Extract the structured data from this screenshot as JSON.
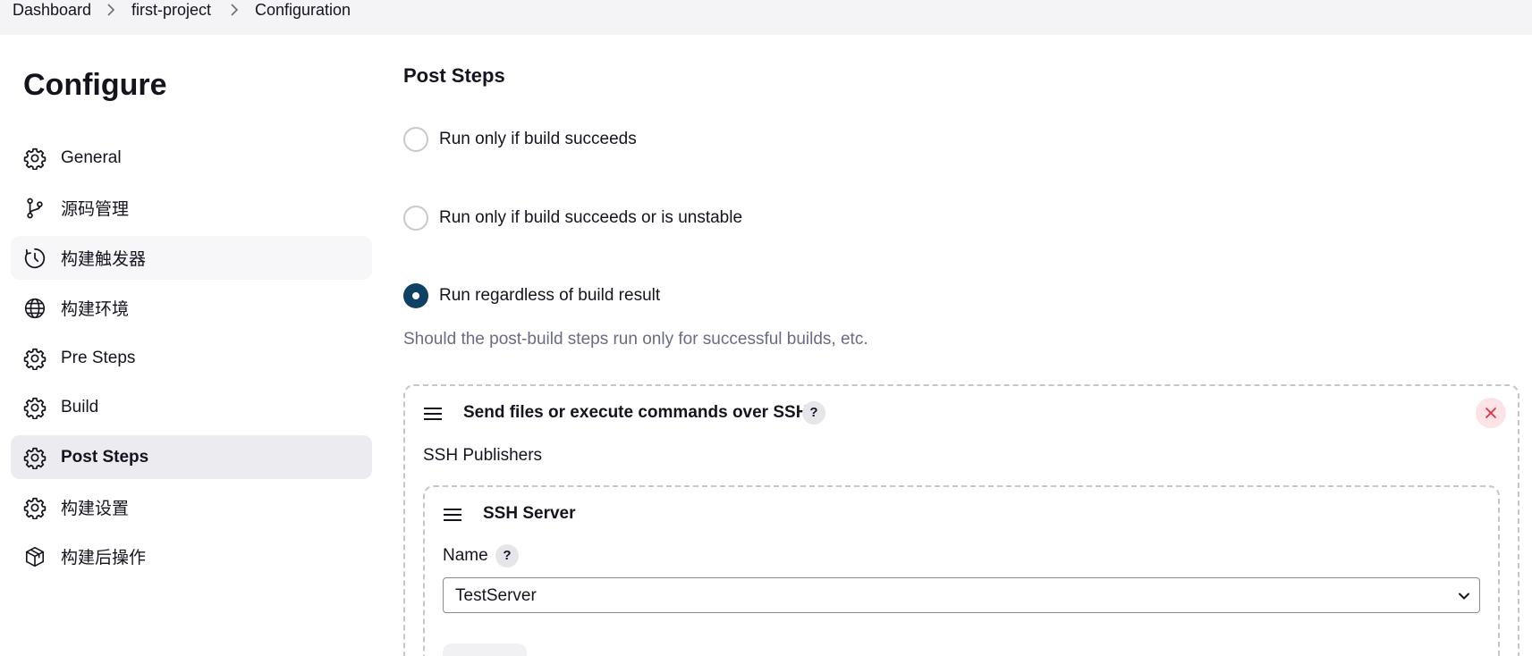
{
  "breadcrumb": {
    "items": [
      "Dashboard",
      "first-project",
      "Configuration"
    ]
  },
  "sidebar": {
    "heading": "Configure",
    "items": [
      {
        "label": "General",
        "icon": "gear-icon"
      },
      {
        "label": "源码管理",
        "icon": "source-control-icon"
      },
      {
        "label": "构建触发器",
        "icon": "clock-icon"
      },
      {
        "label": "构建环境",
        "icon": "globe-icon"
      },
      {
        "label": "Pre Steps",
        "icon": "gear-icon"
      },
      {
        "label": "Build",
        "icon": "gear-icon"
      },
      {
        "label": "Post Steps",
        "icon": "gear-icon"
      },
      {
        "label": "构建设置",
        "icon": "gear-icon"
      },
      {
        "label": "构建后操作",
        "icon": "package-icon"
      }
    ],
    "active_item": "Post Steps",
    "hovered_item": "构建触发器"
  },
  "main": {
    "section_title": "Post Steps",
    "radio_options": [
      {
        "label": "Run only if build succeeds",
        "checked": false
      },
      {
        "label": "Run only if build succeeds or is unstable",
        "checked": false
      },
      {
        "label": "Run regardless of build result",
        "checked": true
      }
    ],
    "help_text": "Should the post-build steps run only for successful builds, etc.",
    "publisher_block": {
      "title": "Send files or execute commands over SSH",
      "help": "?",
      "subtitle": "SSH Publishers",
      "server_block": {
        "title": "SSH Server",
        "name_label": "Name",
        "name_help": "?",
        "selected_server": "TestServer"
      }
    }
  },
  "colors": {
    "radio_checked": "#0e4164",
    "active_nav_bg": "#ebebf0",
    "close_button_bg": "#fbe3e6",
    "close_icon": "#e0293c",
    "help_text": "#6b6b85"
  }
}
